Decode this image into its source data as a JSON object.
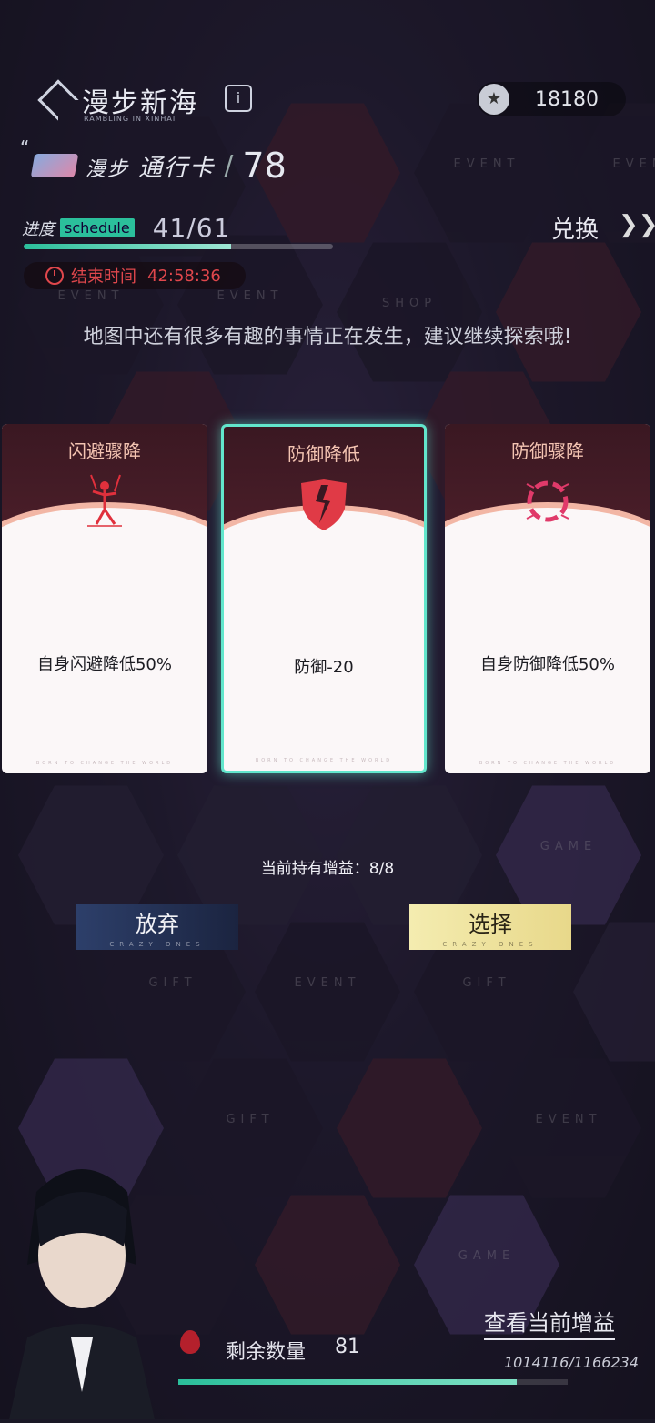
{
  "header": {
    "title": "漫步新海",
    "subtitle": "RAMBLING IN XINHAI",
    "info_icon": "info-icon",
    "coins": "18180"
  },
  "pass": {
    "quote": "“",
    "label_prefix": "漫步",
    "label_main": "通行卡",
    "slash": "/",
    "level": "78"
  },
  "progress": {
    "label": "进度",
    "badge": "schedule",
    "count": "41/61",
    "fraction": 0.672
  },
  "exchange": {
    "label": "兑换",
    "arrows": "❯❯"
  },
  "timer": {
    "label": "结束时间",
    "value": "42:58:36"
  },
  "hint": "地图中还有很多有趣的事情正在发生，建议继续探索哦!",
  "board_labels": {
    "event": "EVENT",
    "shop": "SHOP",
    "game": "GAME",
    "gift": "GIFT"
  },
  "cards": [
    {
      "title": "闪避骤降",
      "desc": "自身闪避降低50%",
      "icon": "puppet-icon",
      "footer": "BORN TO CHANGE THE WORLD",
      "selected": false
    },
    {
      "title": "防御降低",
      "desc": "防御-20",
      "icon": "broken-shield-icon",
      "footer": "BORN TO CHANGE THE WORLD",
      "selected": true
    },
    {
      "title": "防御骤降",
      "desc": "自身防御降低50%",
      "icon": "broken-ring-icon",
      "footer": "BORN TO CHANGE THE WORLD",
      "selected": false
    }
  ],
  "buff_count": "当前持有增益：8/8",
  "buttons": {
    "abandon": "放弃",
    "select": "选择",
    "sub": "CRAZY ONES"
  },
  "bottom": {
    "remain_label": "剩余数量",
    "remain_value": "81",
    "view_buff": "查看当前增益",
    "hp": "1014116/1166234",
    "hp_fraction": 0.87
  },
  "colors": {
    "accent_teal": "#62e6cc",
    "timer_red": "#e0474c",
    "select_gold": "#f4ecb0"
  }
}
